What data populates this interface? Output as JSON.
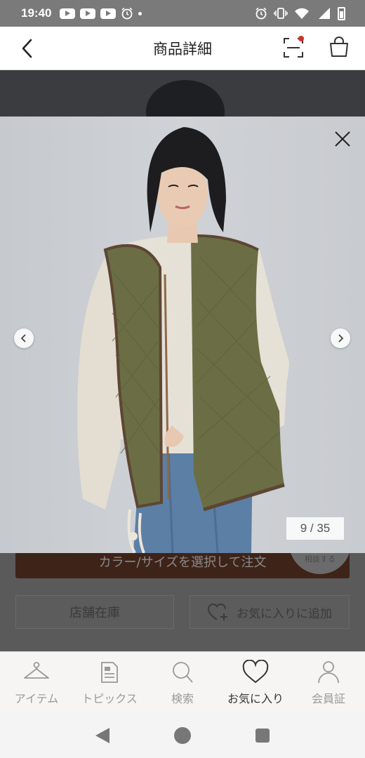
{
  "status_bar": {
    "time": "19:40",
    "left_icons": [
      "youtube-icon",
      "youtube-icon",
      "youtube-icon",
      "alarm-icon",
      "dot"
    ],
    "right_icons": [
      "alarm-icon",
      "vibrate-icon",
      "wifi-icon",
      "signal-icon",
      "battery-icon"
    ]
  },
  "header": {
    "title": "商品詳細",
    "back_icon": "chevron-left-icon",
    "scan_icon": "scan-icon",
    "cart_icon": "shopping-bag-icon",
    "notification_dot_color": "#d0312d"
  },
  "background_page": {
    "buy_button_label": "カラー/サイズを選択して注文",
    "circle_button_label": "相談する",
    "store_stock_label": "店舗在庫",
    "favorite_add_label": "お気に入りに追加"
  },
  "image_viewer": {
    "counter": "9 / 35",
    "close_icon": "close-icon",
    "prev_icon": "chevron-left-icon",
    "next_icon": "chevron-right-icon"
  },
  "bottom_nav": {
    "items": [
      {
        "label": "アイテム",
        "icon": "hanger-icon",
        "active": false
      },
      {
        "label": "トピックス",
        "icon": "document-icon",
        "active": false
      },
      {
        "label": "検索",
        "icon": "search-icon",
        "active": false
      },
      {
        "label": "お気に入り",
        "icon": "heart-icon",
        "active": true
      },
      {
        "label": "会員証",
        "icon": "person-icon",
        "active": false
      }
    ]
  },
  "colors": {
    "vest": "#6b6e44",
    "sweater": "#e6e1d7",
    "jeans": "#5c7fa6",
    "brand_button": "#3e2319"
  }
}
